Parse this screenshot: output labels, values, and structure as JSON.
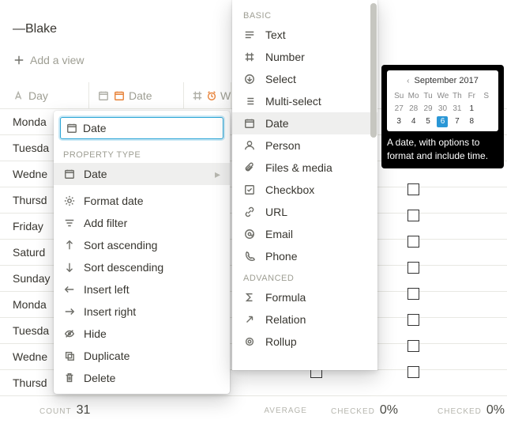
{
  "title_author": "—Blake",
  "add_view": "Add a view",
  "columns": {
    "day": "Day",
    "date": "Date",
    "wk": "W"
  },
  "rows": [
    "Monda",
    "Tuesda",
    "Wedne",
    "Thursd",
    "Friday",
    "Saturd",
    "Sunday",
    "Monda",
    "Tuesda",
    "Wedne",
    "Thursd"
  ],
  "footer": {
    "count_label": "COUNT",
    "count": "31",
    "average_label": "AVERAGE",
    "checked1_label": "CHECKED",
    "checked1": "0%",
    "checked2_label": "CHECKED",
    "checked2": "0%"
  },
  "ctx": {
    "input_value": "Date",
    "section_type": "PROPERTY TYPE",
    "type_date": "Date",
    "format_date": "Format date",
    "add_filter": "Add filter",
    "sort_asc": "Sort ascending",
    "sort_desc": "Sort descending",
    "insert_left": "Insert left",
    "insert_right": "Insert right",
    "hide": "Hide",
    "duplicate": "Duplicate",
    "delete": "Delete"
  },
  "types": {
    "basic": "BASIC",
    "text": "Text",
    "number": "Number",
    "select": "Select",
    "multi": "Multi-select",
    "date": "Date",
    "person": "Person",
    "files": "Files & media",
    "checkbox": "Checkbox",
    "url": "URL",
    "email": "Email",
    "phone": "Phone",
    "advanced": "ADVANCED",
    "formula": "Formula",
    "relation": "Relation",
    "rollup": "Rollup"
  },
  "tooltip": {
    "month": "September 2017",
    "wk_head": [
      "Su",
      "Mo",
      "Tu",
      "We",
      "Th",
      "Fr",
      "S"
    ],
    "r1": [
      "27",
      "28",
      "29",
      "30",
      "31",
      "1",
      ""
    ],
    "r2": [
      "3",
      "4",
      "5",
      "6",
      "7",
      "8",
      ""
    ],
    "text": "A date, with options to format and include time."
  }
}
